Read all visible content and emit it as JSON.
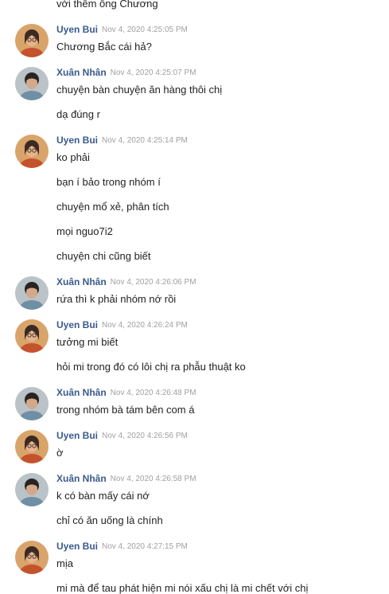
{
  "users": {
    "uyen": {
      "name": "Uyen Bui",
      "avatar_icon": "woman-with-glasses-avatar",
      "avatar_colors": {
        "bg": "#d9a46a",
        "hair": "#3b2a22",
        "face": "#e8b48f",
        "top": "#c4532d"
      }
    },
    "xuan": {
      "name": "Xuân Nhân",
      "avatar_icon": "man-portrait-avatar",
      "avatar_colors": {
        "bg": "#b9c3c8",
        "hair": "#2a2420",
        "face": "#d4a88a",
        "top": "#6f8fa5"
      }
    }
  },
  "colors": {
    "name": "#3a5a8c",
    "time": "#a0a0a0",
    "text": "#222222"
  },
  "messages": [
    {
      "type": "text",
      "text": "với thêm ông Chương"
    },
    {
      "type": "header",
      "user": "uyen",
      "time": "Nov 4, 2020 4:25:05 PM"
    },
    {
      "type": "text",
      "text": "Chương Bắc cái hả?"
    },
    {
      "type": "header",
      "user": "xuan",
      "time": "Nov 4, 2020 4:25:07 PM"
    },
    {
      "type": "text",
      "text": "chuyện bàn chuyện ăn hàng thôi chị"
    },
    {
      "type": "text",
      "text": "dạ đúng r"
    },
    {
      "type": "header",
      "user": "uyen",
      "time": "Nov 4, 2020 4:25:14 PM"
    },
    {
      "type": "text",
      "text": "ko phải"
    },
    {
      "type": "text",
      "text": "bạn í bảo trong nhóm í"
    },
    {
      "type": "text",
      "text": "chuyện mổ xẻ, phân tích"
    },
    {
      "type": "text",
      "text": "mọi nguo7i2"
    },
    {
      "type": "text",
      "text": "chuyện chi cũng biết"
    },
    {
      "type": "header",
      "user": "xuan",
      "time": "Nov 4, 2020 4:26:06 PM"
    },
    {
      "type": "text",
      "text": "rứa thì k phải nhóm nớ rồi"
    },
    {
      "type": "header",
      "user": "uyen",
      "time": "Nov 4, 2020 4:26:24 PM"
    },
    {
      "type": "text",
      "text": "tưởng mi biết"
    },
    {
      "type": "text",
      "text": "hỏi mi trong đó có lôi chị ra phẫu thuật ko"
    },
    {
      "type": "header",
      "user": "xuan",
      "time": "Nov 4, 2020 4:26:48 PM"
    },
    {
      "type": "text",
      "text": "trong nhóm bà tám bên com á"
    },
    {
      "type": "header",
      "user": "uyen",
      "time": "Nov 4, 2020 4:26:56 PM"
    },
    {
      "type": "text",
      "text": "ờ"
    },
    {
      "type": "header",
      "user": "xuan",
      "time": "Nov 4, 2020 4:26:58 PM"
    },
    {
      "type": "text",
      "text": "k có bàn mấy cái nớ"
    },
    {
      "type": "text",
      "text": "chỉ có ăn uống là chính"
    },
    {
      "type": "header",
      "user": "uyen",
      "time": "Nov 4, 2020 4:27:15 PM"
    },
    {
      "type": "text",
      "text": "mịa"
    },
    {
      "type": "text",
      "text": "mi mà để tau phát hiện mi nói xấu chị là mi chết với chị"
    }
  ]
}
